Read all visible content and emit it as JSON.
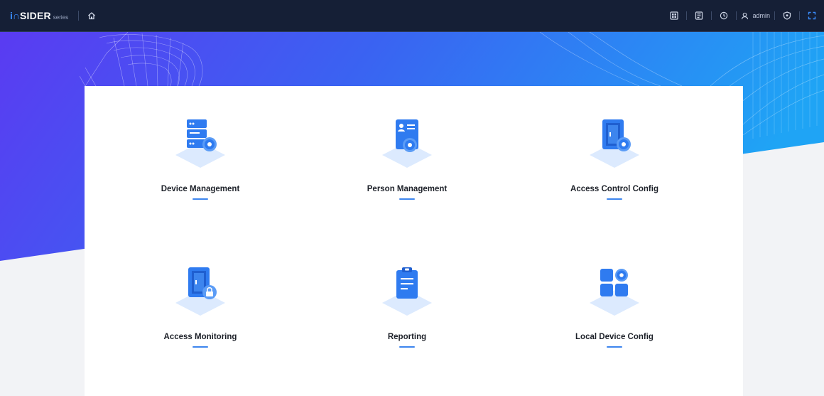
{
  "header": {
    "brand_mark": "i∩",
    "brand": "SIDER",
    "series": "series",
    "user_name": "admin",
    "icons": [
      "home-icon",
      "grid-view-icon",
      "card-icon",
      "clock-icon",
      "user-icon",
      "shield-icon",
      "fullscreen-icon"
    ]
  },
  "tiles": [
    {
      "label": "Device Management",
      "icon": "device-management-icon"
    },
    {
      "label": "Person Management",
      "icon": "person-management-icon"
    },
    {
      "label": "Access Control Config",
      "icon": "access-control-config-icon"
    },
    {
      "label": "Access Monitoring",
      "icon": "access-monitoring-icon"
    },
    {
      "label": "Reporting",
      "icon": "reporting-icon"
    },
    {
      "label": "Local Device Config",
      "icon": "local-device-config-icon"
    }
  ],
  "colors": {
    "topbar": "#151f36",
    "accent": "#3d85ee",
    "hero_start": "#5a3bf2",
    "hero_end": "#1fa4f5",
    "icon_blue": "#2f7bf0"
  }
}
